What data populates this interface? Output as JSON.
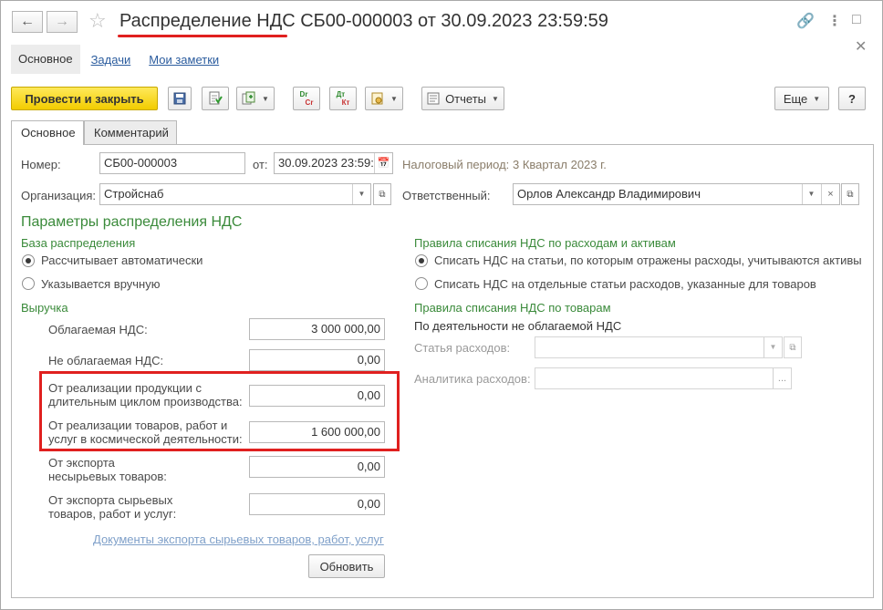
{
  "window": {
    "title": "Распределение НДС СБ00-000003 от 30.09.2023 23:59:59"
  },
  "section_nav": {
    "main": "Основное",
    "tasks": "Задачи",
    "notes": "Мои заметки"
  },
  "toolbar": {
    "post_close": "Провести и закрыть",
    "reports": "Отчеты",
    "more": "Еще",
    "help": "?",
    "dt_kt_icon_text": "Дт Кт",
    "dr_cr_icon_text": "Dr Cr"
  },
  "tabs": [
    "Основное",
    "Комментарий"
  ],
  "header_fields": {
    "number_label": "Номер:",
    "number_value": "СБ00-000003",
    "date_label": "от:",
    "date_value": "30.09.2023 23:59:",
    "tax_period_label": "Налоговый период:",
    "tax_period_value": "3 Квартал 2023  г.",
    "org_label": "Организация:",
    "org_value": "Стройснаб",
    "responsible_label": "Ответственный:",
    "responsible_value": "Орлов Александр Владимирович"
  },
  "params": {
    "heading": "Параметры распределения НДС",
    "base_heading": "База распределения",
    "base_auto": "Рассчитывает автоматически",
    "base_manual": "Указывается вручную",
    "base_selected": "auto",
    "revenue_heading": "Выручка",
    "revenue_rows": [
      {
        "label_lines": [
          "Облагаемая НДС:"
        ],
        "value": "3 000 000,00"
      },
      {
        "label_lines": [
          "Не облагаемая НДС:"
        ],
        "value": "0,00"
      },
      {
        "label_lines": [
          "От реализации продукции с",
          "длительным циклом производства:"
        ],
        "value": "0,00"
      },
      {
        "label_lines": [
          "От реализации товаров, работ и",
          "услуг в космической деятельности:"
        ],
        "value": "1 600 000,00"
      },
      {
        "label_lines": [
          "От экспорта",
          "несырьевых товаров:"
        ],
        "value": "0,00"
      },
      {
        "label_lines": [
          "От экспорта сырьевых",
          "товаров, работ и услуг:"
        ],
        "value": "0,00"
      }
    ],
    "export_docs_link": "Документы экспорта сырьевых товаров, работ, услуг",
    "refresh_button": "Обновить"
  },
  "writeoff": {
    "expenses_heading": "Правила списания НДС по расходам и активам",
    "expenses_opt1": "Списать НДС на статьи, по которым отражены расходы, учитываются активы",
    "expenses_opt2": "Списать НДС на отдельные статьи расходов, указанные для товаров",
    "expenses_selected": "opt1",
    "goods_heading": "Правила списания НДС по товарам",
    "goods_subheading": "По деятельности не облагаемой НДС",
    "expense_item_label": "Статья расходов:",
    "expense_analytics_label": "Аналитика расходов:",
    "ellipsis": "..."
  },
  "colors": {
    "accent_green": "#3a8a3a",
    "highlight_red": "#e0201f",
    "primary_button": "#f2cc00",
    "link_blue": "#2b5c9e"
  }
}
